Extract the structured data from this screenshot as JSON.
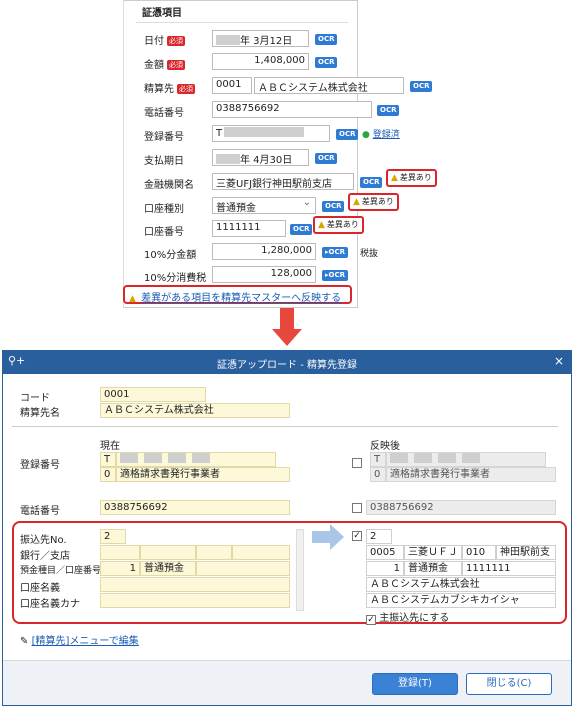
{
  "top_form": {
    "section_title": "証憑項目",
    "required_label": "必須",
    "ocr_label": "OCR",
    "warn_label": "差異あり",
    "fields": {
      "date": {
        "label": "日付",
        "value_suffix": "年  3月12日"
      },
      "amount": {
        "label": "金額",
        "value": "1,408,000"
      },
      "payee": {
        "label": "精算先",
        "code": "0001",
        "name": "ＡＢＣシステム株式会社"
      },
      "phone": {
        "label": "電話番号",
        "value": "0388756692"
      },
      "reg_no": {
        "label": "登録番号",
        "value_prefix": "T",
        "status": "登録済"
      },
      "due_date": {
        "label": "支払期日",
        "value_suffix": "年  4月30日"
      },
      "bank": {
        "label": "金融機関名",
        "value": "三菱UFJ銀行神田駅前支店"
      },
      "acct_type": {
        "label": "口座種別",
        "value": "普通預金"
      },
      "acct_no": {
        "label": "口座番号",
        "value": "1111111"
      },
      "amt10": {
        "label": "10%分金額",
        "value": "1,280,000",
        "tax_label": "税抜"
      },
      "tax10": {
        "label": "10%分消費税",
        "value": "128,000"
      }
    },
    "reflect_link": "差異がある項目を精算先マスターへ反映する"
  },
  "dialog": {
    "title": "証憑アップロード - 精算先登録",
    "close": "×",
    "code_label": "コード",
    "code_value": "0001",
    "name_label": "精算先名",
    "name_value": "ＡＢＣシステム株式会社",
    "current_header": "現在",
    "after_header": "反映後",
    "reg_label": "登録番号",
    "reg_prefix": "T",
    "reg_type_code": "0",
    "reg_type": "適格請求書発行事業者",
    "phone_label": "電話番号",
    "phone_value": "0388756692",
    "bank_labels": {
      "transfer_no": "振込先No.",
      "bank_branch": "銀行／支店",
      "acct": "預金種目／口座番号",
      "acct_name": "口座名義",
      "acct_kana": "口座名義カナ"
    },
    "current_bank": {
      "transfer_no": "2",
      "acct_type_code": "1",
      "acct_type": "普通預金"
    },
    "after_bank": {
      "transfer_no": "2",
      "bank_code": "0005",
      "bank_name": "三菱ＵＦＪ",
      "branch_code": "010",
      "branch_name": "神田駅前支",
      "acct_type_code": "1",
      "acct_type": "普通預金",
      "acct_no": "1111111",
      "acct_name": "ＡＢＣシステム株式会社",
      "acct_kana": "ＡＢＣシステムカブシキカイシャ",
      "main_label": "主振込先にする"
    },
    "edit_link": "[精算先]メニューで編集",
    "register_button": "登録(T)",
    "close_button": "閉じる(C)"
  }
}
